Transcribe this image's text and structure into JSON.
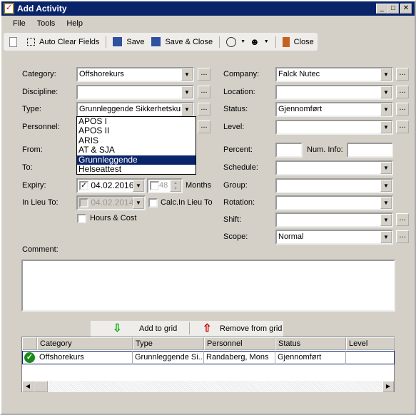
{
  "window": {
    "title": "Add Activity"
  },
  "menu": [
    "File",
    "Tools",
    "Help"
  ],
  "toolbar": {
    "auto_clear": "Auto Clear Fields",
    "save": "Save",
    "save_close": "Save & Close",
    "close": "Close"
  },
  "left": {
    "category": {
      "label": "Category:",
      "value": "Offshorekurs"
    },
    "discipline": {
      "label": "Discipline:",
      "value": ""
    },
    "type": {
      "label": "Type:",
      "value": "Grunnleggende Sikkerhetskurs"
    },
    "personnel": {
      "label": "Personnel:"
    },
    "from": {
      "label": "From:"
    },
    "to": {
      "label": "To:"
    },
    "expiry": {
      "label": "Expiry:",
      "date": "04.02.2016",
      "checked": true,
      "months": "48",
      "months_label": "Months"
    },
    "inlieu": {
      "label": "In Lieu To:",
      "date": "04.02.2014",
      "calc_label": "Calc.In Lieu To"
    },
    "hours_label": "Hours & Cost"
  },
  "type_options": [
    "APOS I",
    "APOS II",
    "ARIS",
    "AT & SJA",
    "Grunnleggende Sikkerhetskurs",
    "Helseattest"
  ],
  "right": {
    "company": {
      "label": "Company:",
      "value": "Falck Nutec"
    },
    "location": {
      "label": "Location:",
      "value": ""
    },
    "status": {
      "label": "Status:",
      "value": "Gjennomført"
    },
    "level": {
      "label": "Level:",
      "value": ""
    },
    "percent": {
      "label": "Percent:",
      "value": ""
    },
    "num_info": {
      "label": "Num. Info:",
      "value": ""
    },
    "schedule": {
      "label": "Schedule:",
      "value": ""
    },
    "group": {
      "label": "Group:",
      "value": ""
    },
    "rotation": {
      "label": "Rotation:",
      "value": ""
    },
    "shift": {
      "label": "Shift:",
      "value": ""
    },
    "scope": {
      "label": "Scope:",
      "value": "Normal"
    }
  },
  "comment": {
    "label": "Comment:",
    "value": ""
  },
  "grid_actions": {
    "add": "Add to grid",
    "remove": "Remove from grid"
  },
  "grid": {
    "columns": [
      "Category",
      "Type",
      "Personnel",
      "Status",
      "Level"
    ],
    "rows": [
      [
        "Offshorekurs",
        "Grunnleggende Si...",
        "Randaberg, Mons",
        "Gjennomført",
        ""
      ]
    ]
  }
}
